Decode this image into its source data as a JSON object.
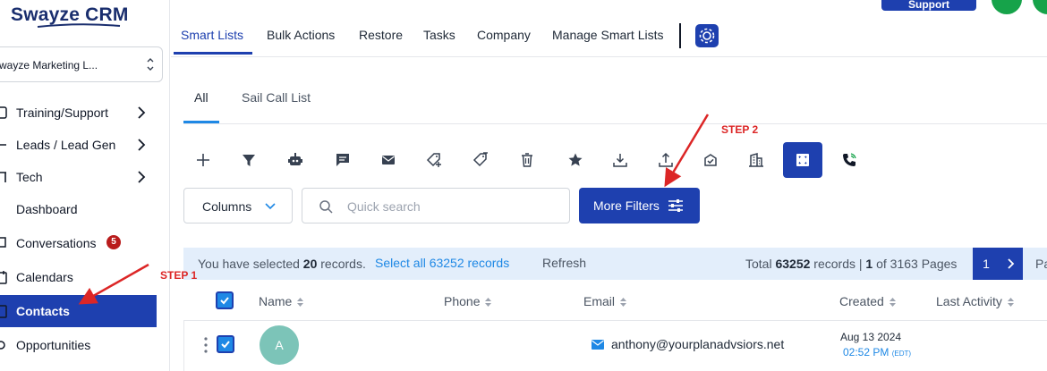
{
  "app": {
    "logo": "Swayze CRM",
    "account_name": "wayze Marketing L..."
  },
  "sidebar": {
    "items": [
      {
        "label": "Training/Support",
        "icon": "book-icon",
        "has_children": true
      },
      {
        "label": "Leads / Lead Gen",
        "icon": "leads-icon",
        "has_children": true
      },
      {
        "label": "Tech",
        "icon": "tech-icon",
        "has_children": true
      },
      {
        "label": "Dashboard",
        "icon": "dashboard-icon",
        "has_children": false
      },
      {
        "label": "Conversations",
        "icon": "chat-icon",
        "has_children": false,
        "badge": "5"
      },
      {
        "label": "Calendars",
        "icon": "calendar-icon",
        "has_children": false
      },
      {
        "label": "Contacts",
        "icon": "contacts-icon",
        "has_children": false,
        "active": true
      },
      {
        "label": "Opportunities",
        "icon": "gear-icon",
        "has_children": false
      }
    ]
  },
  "topbar": {
    "tabs": [
      "Smart Lists",
      "Bulk Actions",
      "Restore",
      "Tasks",
      "Company",
      "Manage Smart Lists"
    ],
    "active_tab": "Smart Lists",
    "support_label": "Support"
  },
  "subtabs": {
    "items": [
      "All",
      "Sail Call List"
    ],
    "active": "All"
  },
  "toolbar": {
    "icons": [
      "add-icon",
      "filter-icon",
      "robot-icon",
      "message-icon",
      "mail-icon",
      "add-tag-icon",
      "remove-tag-icon",
      "trash-icon",
      "star-icon",
      "download-icon",
      "upload-icon",
      "email-verify-icon",
      "company-icon",
      "merge-icon",
      "phone-icon"
    ],
    "active_icon": "merge-icon"
  },
  "controls": {
    "columns_label": "Columns",
    "search_placeholder": "Quick search",
    "more_filters_label": "More Filters"
  },
  "selection": {
    "prefix": "You have selected ",
    "count": "20",
    "suffix": " records.",
    "select_all": "Select all 63252 records",
    "refresh": "Refresh",
    "total_prefix": "Total ",
    "total_count": "63252",
    "total_mid": " records | ",
    "page_current": "1",
    "page_of": " of 3163 Pages",
    "page_button": "1",
    "page_extra": "Pa"
  },
  "table": {
    "headers": [
      "Name",
      "Phone",
      "Email",
      "Created",
      "Last Activity"
    ],
    "rows": [
      {
        "avatar": "A",
        "name": "",
        "phone": "",
        "email": "anthony@yourplanadvsiors.net",
        "created_date": "Aug 13 2024",
        "created_time": "02:52 PM",
        "created_tz": "(EDT)"
      }
    ]
  },
  "annotations": {
    "step1": "STEP 1",
    "step2": "STEP 2"
  },
  "colors": {
    "primary": "#1e40af",
    "link": "#1e88e5",
    "annotation": "#dc2626",
    "selection_bg": "#e3eefb"
  }
}
